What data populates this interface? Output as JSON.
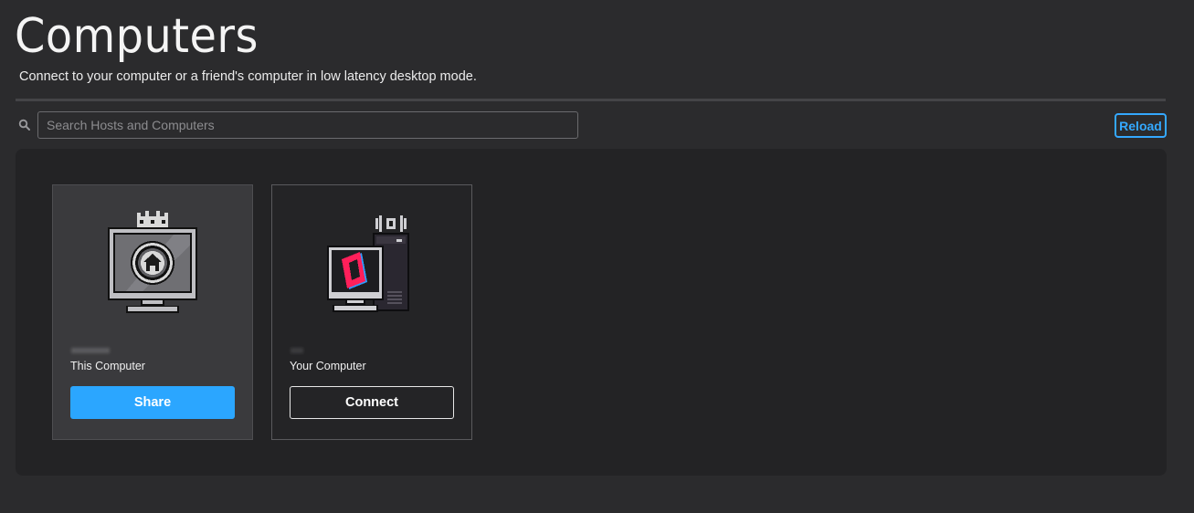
{
  "header": {
    "title": "Computers",
    "subtitle": "Connect to your computer or a friend's computer in low latency desktop mode."
  },
  "search": {
    "icon": "search-icon",
    "placeholder": "Search Hosts and Computers",
    "value": ""
  },
  "toolbar": {
    "reload_label": "Reload"
  },
  "computers": [
    {
      "label": "This Computer",
      "icon": "home-monitor-icon",
      "button_label": "Share",
      "selected": true
    },
    {
      "label": "Your Computer",
      "icon": "pc-tower-icon",
      "button_label": "Connect",
      "selected": false
    }
  ],
  "colors": {
    "background": "#2b2b2d",
    "panel": "#232325",
    "accent": "#2ba6ff",
    "brand_red": "#ff1f5a",
    "brand_blue": "#2f9bff"
  }
}
